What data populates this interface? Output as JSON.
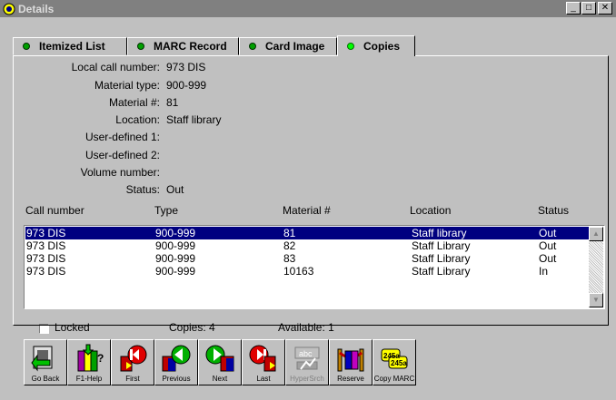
{
  "window": {
    "title": "Details"
  },
  "tabs": [
    {
      "label": "Itemized List"
    },
    {
      "label": "MARC Record"
    },
    {
      "label": "Card Image"
    },
    {
      "label": "Copies"
    }
  ],
  "fields": [
    {
      "label": "Local call number:",
      "value": "973 DIS"
    },
    {
      "label": "Material type:",
      "value": "900-999"
    },
    {
      "label": "Material #:",
      "value": "81"
    },
    {
      "label": "Location:",
      "value": "Staff library"
    },
    {
      "label": "User-defined 1:",
      "value": ""
    },
    {
      "label": "User-defined 2:",
      "value": ""
    },
    {
      "label": "Volume number:",
      "value": ""
    },
    {
      "label": "Status:",
      "value": "Out"
    }
  ],
  "table": {
    "columns": [
      "Call number",
      "Type",
      "Material #",
      "Location",
      "Status"
    ],
    "rows": [
      [
        "973 DIS",
        "900-999",
        "81",
        "Staff library",
        "Out"
      ],
      [
        "973 DIS",
        "900-999",
        "82",
        "Staff Library",
        "Out"
      ],
      [
        "973 DIS",
        "900-999",
        "83",
        "Staff Library",
        "Out"
      ],
      [
        "973 DIS",
        "900-999",
        "10163",
        "Staff Library",
        "In"
      ]
    ]
  },
  "status": {
    "locked_label": "Locked",
    "copies": "Copies: 4",
    "available": "Available: 1"
  },
  "toolbar": {
    "go_back": "Go Back",
    "help": "F1-Help",
    "first": "First",
    "previous": "Previous",
    "next": "Next",
    "last": "Last",
    "hypersrch": "HyperSrch",
    "reserve": "Reserve",
    "copy_marc": "Copy MARC",
    "marc_icon_text": "245a"
  }
}
